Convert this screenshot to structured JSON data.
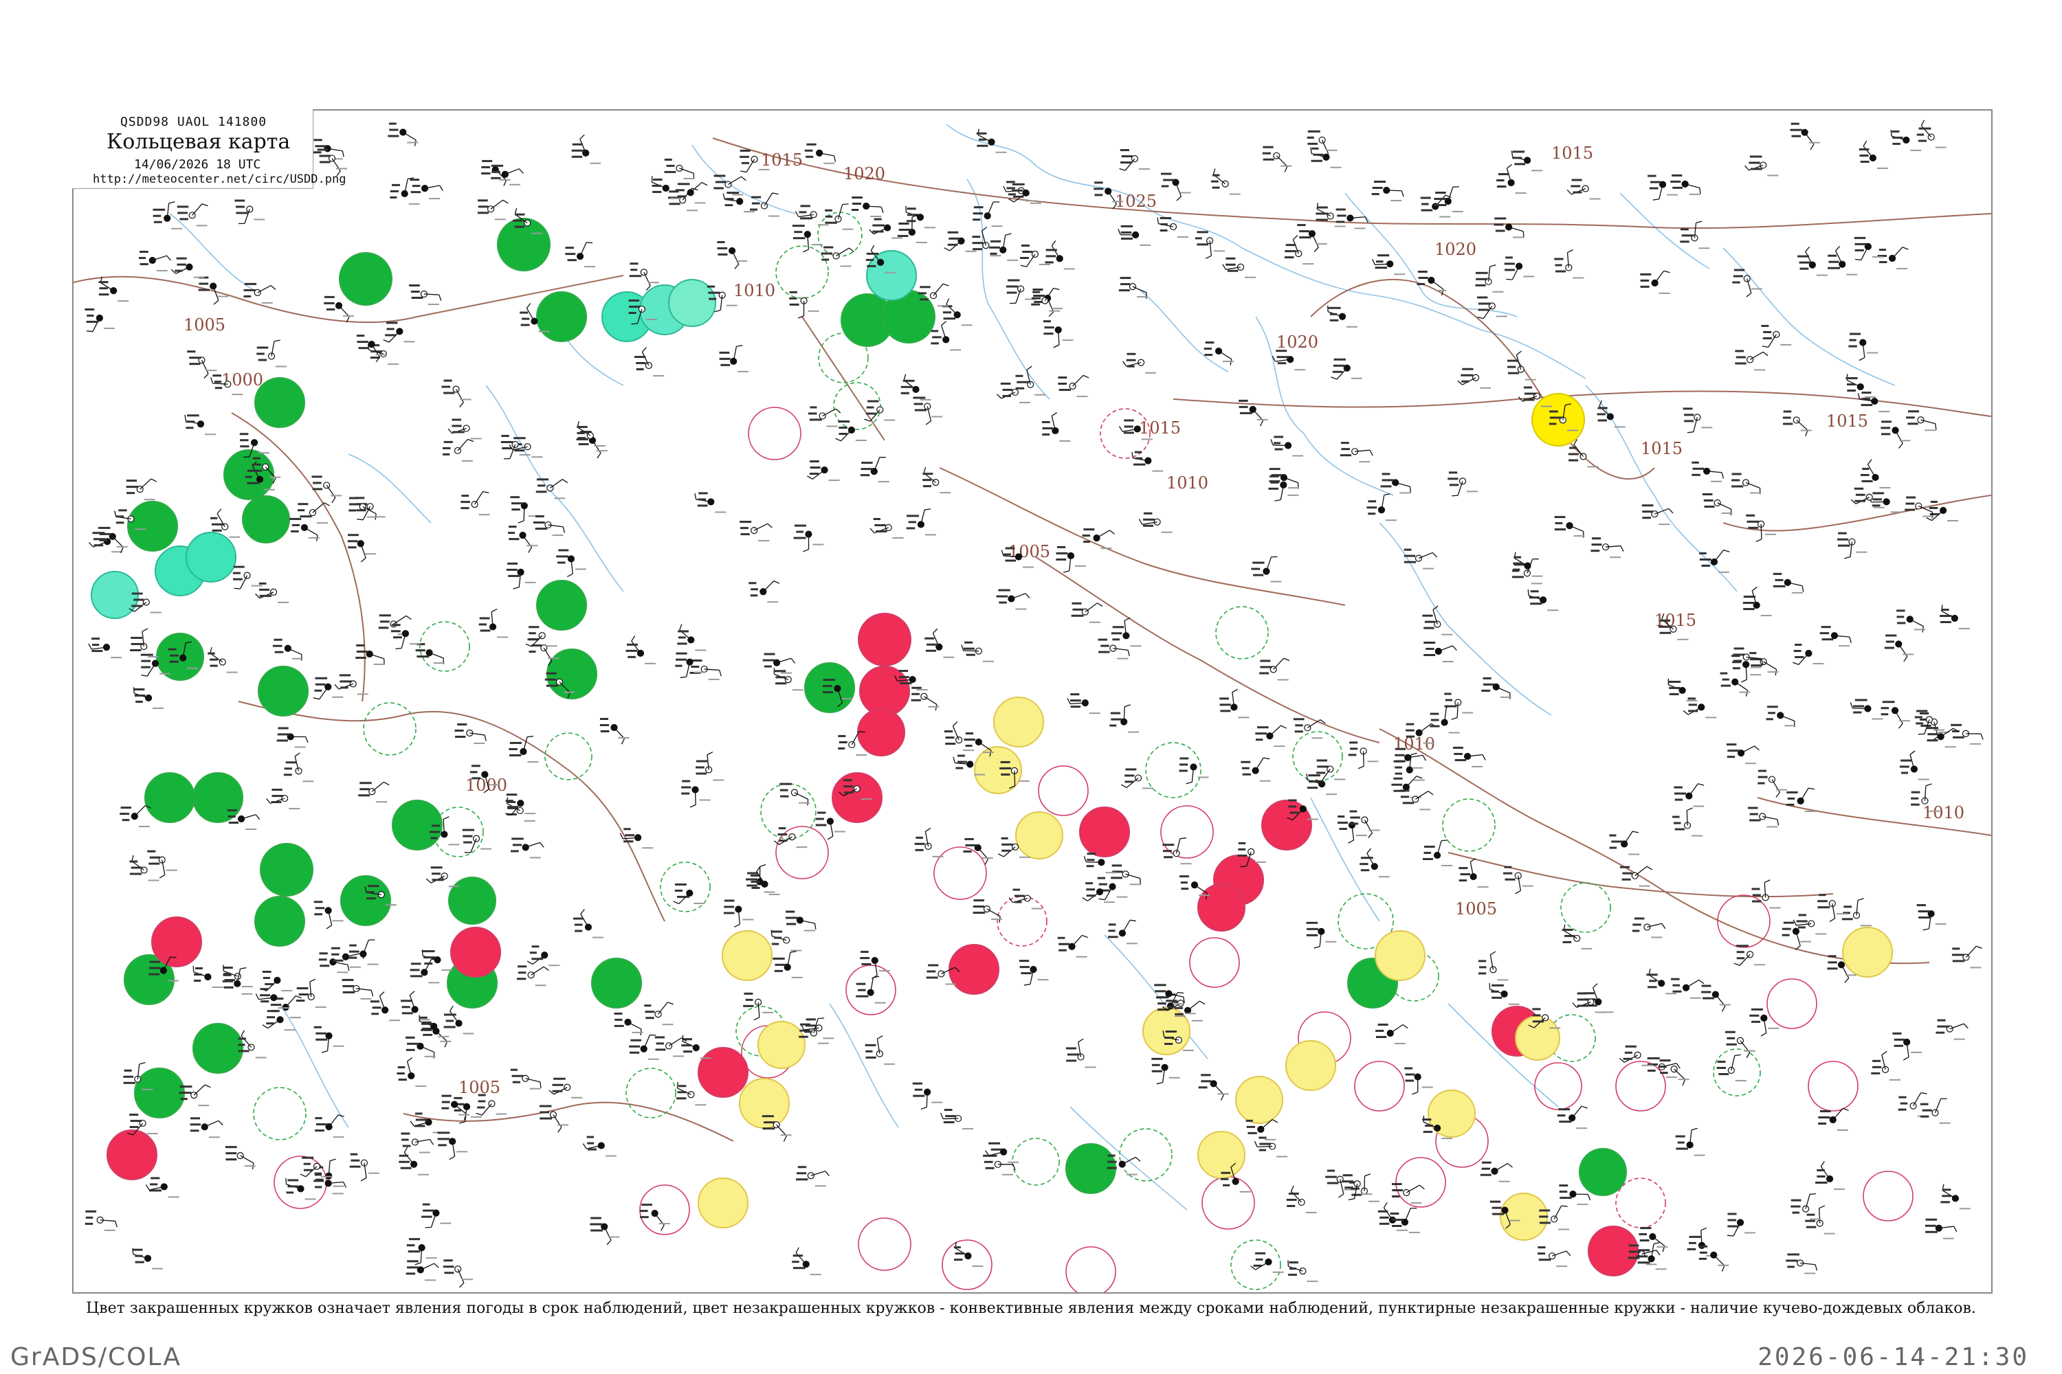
{
  "header": {
    "code": "QSDD98  UAOL  141800",
    "title": "Кольцевая карта",
    "datetime": "14/06/2026 18 UTC",
    "url": "http://meteocenter.net/circ/USDD.png"
  },
  "isobars": [
    "1025",
    "1020",
    "1015",
    "1010",
    "1005",
    "1000"
  ],
  "caption": "Цвет закрашенных кружков означает явления погоды в срок наблюдений, цвет незакрашенных кружков - конвективные явления между сроками наблюдений, пунктирные незакрашенные кружки - наличие кучево-дождевых облаков.",
  "footer": {
    "left": "GrADS/COLA",
    "right": "2026-06-14-21:30"
  },
  "colors": {
    "filled_green": "#16b33a",
    "filled_red": "#ef2d56",
    "filled_yellow": "#faf08a",
    "filled_bright_yellow": "#ffee00",
    "filled_cyan": "#3fe3b8",
    "ring_green": "#2eaa46",
    "ring_red": "#d23c64",
    "isobar": "#a06a5a",
    "water": "#8fc3e6"
  }
}
